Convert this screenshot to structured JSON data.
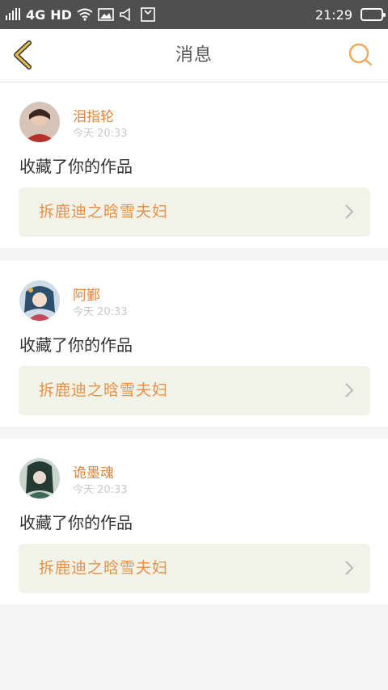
{
  "status_bar": {
    "network": "4G",
    "hd": "HD",
    "time": "21:29",
    "icons": [
      "signal-icon",
      "wifi-icon",
      "image-icon",
      "speaker-icon",
      "clipboard-icon",
      "battery-icon"
    ]
  },
  "header": {
    "title": "消息",
    "back_icon": "chevron-left-icon",
    "search_icon": "search-icon",
    "accent_color": "#e2a44a"
  },
  "notifications": [
    {
      "user": "泪指轮",
      "time": "今天 20:33",
      "action": "收藏了你的作品",
      "work_title": "拆鹿迪之晗雪夫妇",
      "avatar_color": "#5a3a2e"
    },
    {
      "user": "阿鄞",
      "time": "今天 20:33",
      "action": "收藏了你的作品",
      "work_title": "拆鹿迪之晗雪夫妇",
      "avatar_color": "#2f5470"
    },
    {
      "user": "诡墨魂",
      "time": "今天 20:33",
      "action": "收藏了你的作品",
      "work_title": "拆鹿迪之晗雪夫妇",
      "avatar_color": "#3f5a4a"
    }
  ],
  "colors": {
    "username": "#e2843a",
    "work_bg": "#f1f3e8",
    "work_text": "#e79049"
  }
}
